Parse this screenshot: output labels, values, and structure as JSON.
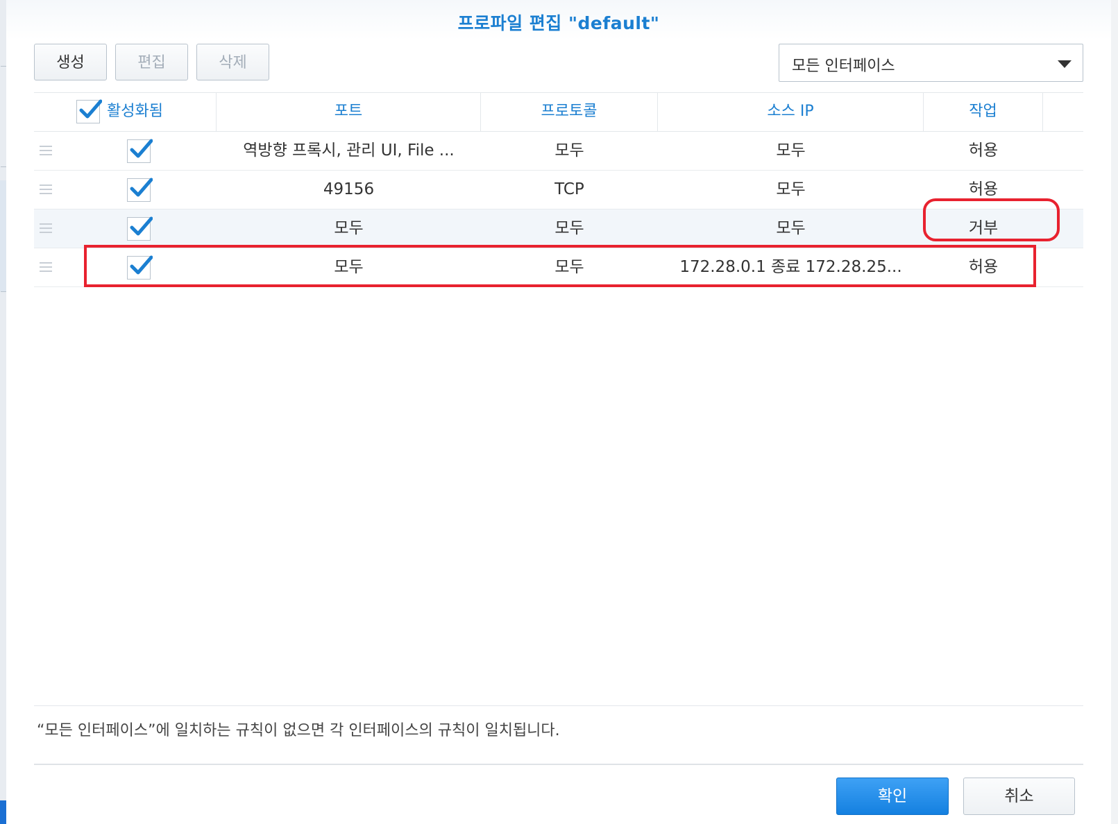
{
  "dialog": {
    "title": "프로파일 편집 \"default\""
  },
  "toolbar": {
    "create_label": "생성",
    "edit_label": "편집",
    "delete_label": "삭제",
    "interface_select": "모든 인터페이스"
  },
  "table": {
    "columns": [
      "활성화됨",
      "포트",
      "프로토콜",
      "소스 IP",
      "작업"
    ],
    "rows": [
      {
        "enabled": true,
        "port": "역방향 프록시, 관리 UI, File ...",
        "protocol": "모두",
        "source_ip": "모두",
        "action": "허용"
      },
      {
        "enabled": true,
        "port": "49156",
        "protocol": "TCP",
        "source_ip": "모두",
        "action": "허용"
      },
      {
        "enabled": true,
        "port": "모두",
        "protocol": "모두",
        "source_ip": "모두",
        "action": "거부"
      },
      {
        "enabled": true,
        "port": "모두",
        "protocol": "모두",
        "source_ip": "172.28.0.1 종료 172.28.25...",
        "action": "허용"
      }
    ]
  },
  "footer": {
    "note": "“모든 인터페이스”에 일치하는 규칙이 없으면 각 인터페이스의 규칙이 일치됩니다.",
    "ok_label": "확인",
    "cancel_label": "취소"
  },
  "colors": {
    "accent": "#1b7fd1",
    "highlight": "#e8222f",
    "primary_button": "#1480e0"
  },
  "icons": [
    "check-icon",
    "drag-handle-icon",
    "chevron-down-icon"
  ]
}
